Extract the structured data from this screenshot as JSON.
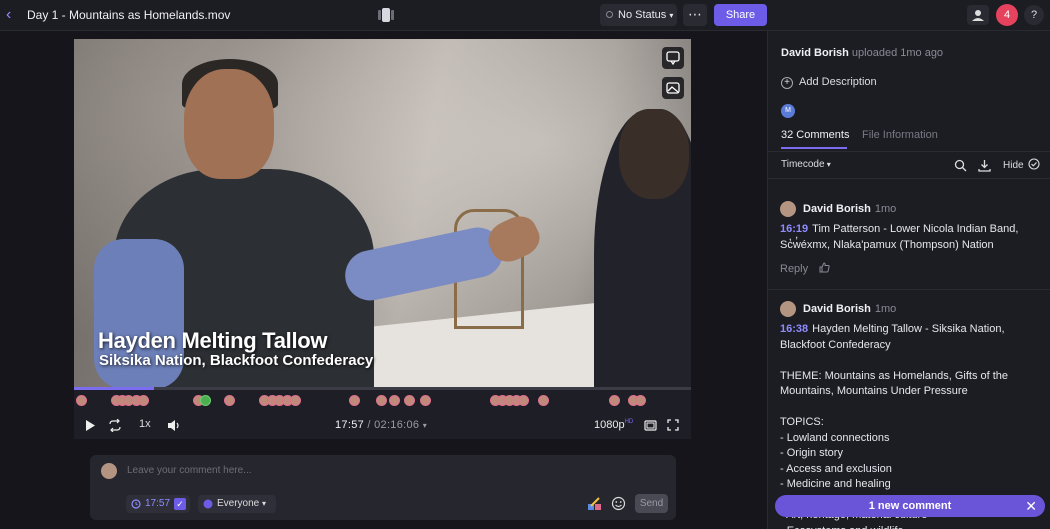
{
  "header": {
    "title": "Day 1 - Mountains as Homelands.mov",
    "status_label": "No Status",
    "more_label": "⋯",
    "share_label": "Share",
    "notification_count": "4",
    "help_label": "?"
  },
  "video": {
    "lower_third_name": "Hayden Melting Tallow",
    "lower_third_sub": "Siksika Nation, Blackfoot Confederacy",
    "progress_fraction": 0.13,
    "playback_speed": "1x",
    "current_time": "17:57",
    "total_time": "02:16:06",
    "resolution": "1080p",
    "resolution_badge": "HD"
  },
  "composer": {
    "placeholder": "Leave your comment here...",
    "timecode": "17:57",
    "audience": "Everyone",
    "send_label": "Send"
  },
  "panel": {
    "uploader_name": "David Borish",
    "uploader_meta": "uploaded 1mo ago",
    "add_description": "Add Description",
    "mini_avatar_initial": "M",
    "tab_comments": "32 Comments",
    "tab_info": "File Information",
    "sort_label": "Timecode",
    "hide_label": "Hide"
  },
  "comments": [
    {
      "author": "David Borish",
      "ago": "1mo",
      "timestamp": "16:19",
      "text": "Tim Patterson - Lower Nicola Indian Band, Sc̓w̓éxmx, Nlaka'pamux (Thompson) Nation",
      "reply_label": "Reply"
    },
    {
      "author": "David Borish",
      "ago": "1mo",
      "timestamp": "16:38",
      "text": "Hayden Melting Tallow - Siksika Nation, Blackfoot Confederacy\n\nTHEME: Mountains as Homelands, Gifts of the Mountains, Mountains Under Pressure\n\nTOPICS:\n- Lowland connections\n- Origin story\n- Access and exclusion\n- Medicine and healing\n- Cross-generational transmission\n- Art, heritage, material culture\n- Ecosystems and wildlife"
    }
  ],
  "new_comment_pill": "1 new comment"
}
